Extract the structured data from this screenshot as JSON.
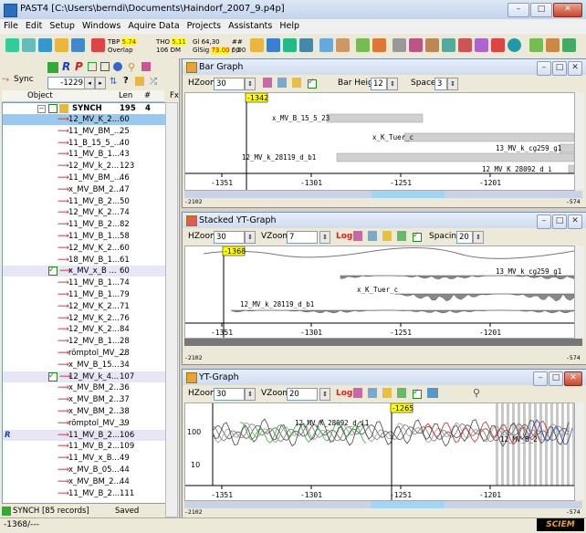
{
  "window": {
    "title": "PAST4 [C:\\Users\\berndi\\Documents\\Haindorf_2007_9.p4p]"
  },
  "menu": [
    "File",
    "Edit",
    "Setup",
    "Windows",
    "Aquire Data",
    "Projects",
    "Assistants",
    "Help"
  ],
  "toolbar": {
    "tbp_label": "TBP",
    "tbp_val": "5.74",
    "overlap_label": "Overlap",
    "tho_label": "THO",
    "tho_val": "5.11",
    "tho_dm": "106 DM",
    "gl_label": "Gl 64,30",
    "glsig_label": "GlSig",
    "glsig_val": "73.00",
    "glsig_extra": "0,00",
    "hash": "##",
    "hash_val": "/ 0"
  },
  "left": {
    "sync_label": "Sync",
    "sync_value": "-1229",
    "columns": [
      "Object",
      "Len",
      "#",
      "Fx"
    ],
    "root": {
      "name": "SYNCH",
      "len": "195",
      "count": "4"
    },
    "rows": [
      {
        "name": "12_MV_K_2...",
        "len": "60",
        "checked": false,
        "sel": true
      },
      {
        "name": "11_MV_BM_...",
        "len": "25",
        "checked": false
      },
      {
        "name": "11_B_15_5_...",
        "len": "40",
        "checked": false
      },
      {
        "name": "11_MV_B_1...",
        "len": "43",
        "checked": false
      },
      {
        "name": "12_MV_k_2...",
        "len": "123",
        "checked": false
      },
      {
        "name": "11_MV_BM_...",
        "len": "46",
        "checked": false
      },
      {
        "name": "x_MV_BM_2...",
        "len": "47",
        "checked": false
      },
      {
        "name": "11_MV_B_2...",
        "len": "50",
        "checked": false
      },
      {
        "name": "12_MV_K_2...",
        "len": "74",
        "checked": false
      },
      {
        "name": "11_MV_B_2...",
        "len": "82",
        "checked": false
      },
      {
        "name": "11_MV_B_1...",
        "len": "58",
        "checked": false
      },
      {
        "name": "12_MV_K_2...",
        "len": "60",
        "checked": false
      },
      {
        "name": "18_MV_B_1...",
        "len": "61",
        "checked": false
      },
      {
        "name": "x_MV_x_B ...",
        "len": "60",
        "checked": true,
        "hl": true
      },
      {
        "name": "11_MV_B_1...",
        "len": "74",
        "checked": false
      },
      {
        "name": "11_MV_B_1...",
        "len": "79",
        "checked": false
      },
      {
        "name": "12_MV_K_2...",
        "len": "71",
        "checked": false
      },
      {
        "name": "12_MV_K_2...",
        "len": "76",
        "checked": false
      },
      {
        "name": "12_MV_K_2...",
        "len": "84",
        "checked": false
      },
      {
        "name": "12_MV_B_1...",
        "len": "28",
        "checked": false
      },
      {
        "name": "römptol_MV_...",
        "len": "28",
        "checked": false
      },
      {
        "name": "x_MV_B_15...",
        "len": "34",
        "checked": false
      },
      {
        "name": "12_MV_k_4...",
        "len": "107",
        "checked": true,
        "hl": true
      },
      {
        "name": "x_MV_BM_2...",
        "len": "36",
        "checked": false
      },
      {
        "name": "x_MV_BM_2...",
        "len": "37",
        "checked": false
      },
      {
        "name": "x_MV_BM_2...",
        "len": "38",
        "checked": false
      },
      {
        "name": "römptol_MV_...",
        "len": "39",
        "checked": false
      },
      {
        "name": "11_MV_B_2...",
        "len": "106",
        "checked": false,
        "hl": true,
        "r": true
      },
      {
        "name": "11_MV_B_2...",
        "len": "109",
        "checked": false
      },
      {
        "name": "11_MV_x_B...",
        "len": "49",
        "checked": false
      },
      {
        "name": "x_MV_B_05...",
        "len": "44",
        "checked": false
      },
      {
        "name": "x_MV_BM_2...",
        "len": "44",
        "checked": false
      },
      {
        "name": "11_MV_B_2...",
        "len": "111",
        "checked": false
      }
    ],
    "footer_records": "SYNCH [85 records]",
    "footer_saved": "Saved"
  },
  "bar_graph": {
    "title": "Bar Graph",
    "hzoom_label": "HZoom",
    "hzoom_value": "30",
    "bar_height_label": "Bar Height",
    "bar_height_value": "12",
    "space_label": "Space",
    "space_value": "3",
    "cursor_label": "-1342",
    "bars": [
      {
        "label": "x_MV_B_15_5_23"
      },
      {
        "label": "x_K_Tuer_c"
      },
      {
        "label": "13_MV_k_cg259_g1"
      },
      {
        "label": "12_MV_k_28119_d_b1"
      },
      {
        "label": "12_MV_K_28092_d_i"
      }
    ],
    "ticks": [
      "-1351",
      "-1301",
      "-1251",
      "-1201"
    ],
    "scroll_left": "-2102",
    "scroll_right": "-574"
  },
  "stacked": {
    "title": "Stacked YT-Graph",
    "hzoom_label": "HZoom",
    "hzoom_value": "30",
    "vzoom_label": "VZoom",
    "vzoom_value": "7",
    "log_label": "Log",
    "spacing_label": "Spacing",
    "spacing_value": "20",
    "cursor_label": "-1368",
    "labels": [
      "13_MV_k_cg259_g1",
      "x_K_Tuer_c",
      "12_MV_k_28119_d_b1"
    ],
    "ticks": [
      "-1351",
      "-1301",
      "-1251",
      "-1201"
    ],
    "scroll_left": "-2102",
    "scroll_right": "-574"
  },
  "yt": {
    "title": "YT-Graph",
    "hzoom_label": "HZoom",
    "hzoom_value": "30",
    "vzoom_label": "VZoom",
    "vzoom_value": "20",
    "log_label": "Log",
    "cursor_label": "-1265",
    "yticks": [
      "100",
      "10"
    ],
    "ticks": [
      "-1351",
      "-1301",
      "-1251",
      "-1201"
    ],
    "labels": [
      "12_MV_K_28092_d_i1",
      "12_MV_B_2"
    ],
    "scroll_left": "-2102",
    "scroll_right": "-574"
  },
  "status": {
    "left": "-1368/---",
    "logo": "SCIEM"
  },
  "colors": {
    "accent": "#316ac5",
    "cursor": "#ffff00"
  }
}
